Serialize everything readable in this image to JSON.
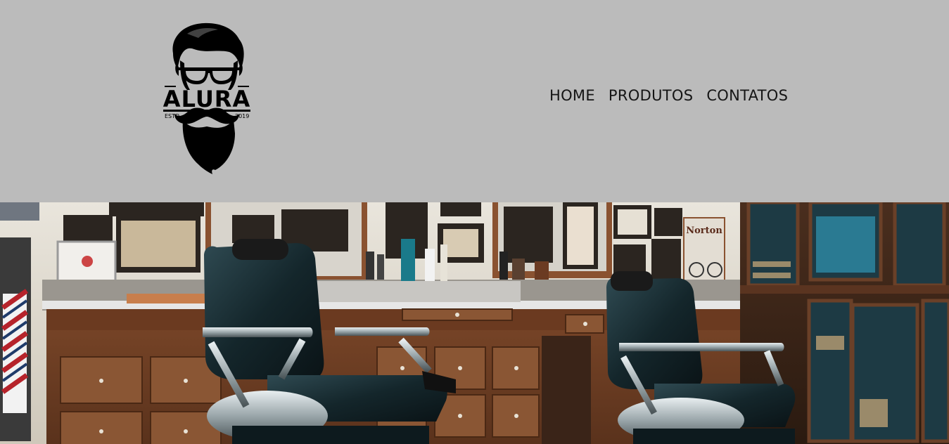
{
  "header": {
    "logo": {
      "brand": "ALURA",
      "left_text": "ESTD",
      "right_text": "2019",
      "icon": "bearded-man-logo-icon"
    },
    "nav": [
      {
        "label": "HOME"
      },
      {
        "label": "PRODUTOS"
      },
      {
        "label": "CONTATOS"
      }
    ]
  },
  "hero": {
    "image": "barbershop-interior-photo",
    "poster_text": "Norton"
  },
  "colors": {
    "header_background": "#bbbbbb",
    "nav_text": "#151515",
    "logo": "#000000"
  }
}
